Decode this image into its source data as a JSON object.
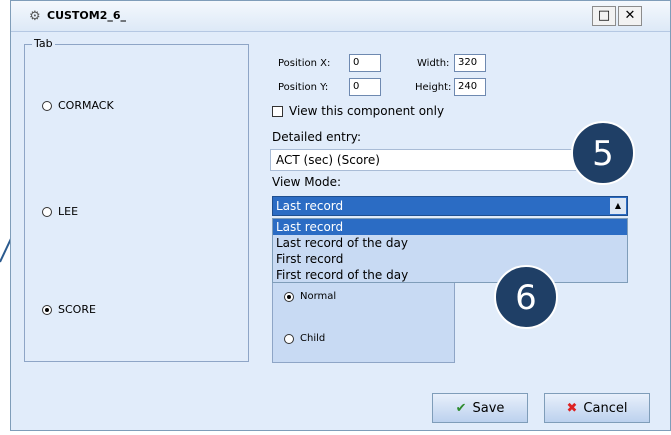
{
  "window": {
    "title": "CUSTOM2_6_"
  },
  "tab_group": {
    "legend": "Tab",
    "options": [
      {
        "label": "CORMACK",
        "selected": false
      },
      {
        "label": "LEE",
        "selected": false
      },
      {
        "label": "SCORE",
        "selected": true
      }
    ]
  },
  "position": {
    "x_label": "Position X:",
    "x_value": "0",
    "y_label": "Position Y:",
    "y_value": "0",
    "width_label": "Width:",
    "width_value": "320",
    "height_label": "Height:",
    "height_value": "240"
  },
  "view_component_only": {
    "label": "View this component only",
    "checked": false
  },
  "detailed_entry": {
    "label": "Detailed entry:",
    "value": "ACT (sec) (Score)"
  },
  "view_mode": {
    "label": "View Mode:",
    "selected": "Last record",
    "options": [
      "Last record",
      "Last record of the day",
      "First record",
      "First record of the day"
    ]
  },
  "child_panel": {
    "options": [
      {
        "label": "Normal",
        "selected": true
      },
      {
        "label": "Child",
        "selected": false
      }
    ]
  },
  "callouts": {
    "five": "5",
    "six": "6"
  },
  "buttons": {
    "save": "Save",
    "cancel": "Cancel"
  }
}
